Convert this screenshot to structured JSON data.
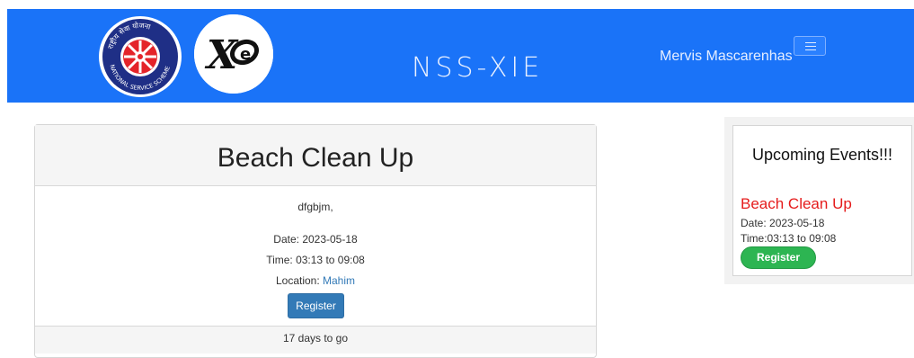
{
  "header": {
    "brand": "NSS-XIE",
    "username": "Mervis Mascarenhas",
    "logos": [
      {
        "name": "nss-logo",
        "alt": "National Service Scheme"
      },
      {
        "name": "xie-logo",
        "alt": "XIE"
      }
    ],
    "nss_logo_text": "राष्ट्रीय सेवा योजना NATIONAL SERVICE SCHEME",
    "xie_logo_text": "XIE",
    "menu_icon": "hamburger-icon",
    "colors": {
      "header_bg": "#1a73f8"
    }
  },
  "event": {
    "title": "Beach Clean Up",
    "description": "dfgbjm,",
    "date": "Date: 2023-05-18",
    "time": "Time: 03:13 to 09:08",
    "location_label": "Location: ",
    "location": "Mahim",
    "register_label": "Register",
    "countdown": "17 days to go",
    "colors": {
      "register_btn": "#337ab7",
      "location_link": "#337ab7"
    }
  },
  "sidebar": {
    "title": "Upcoming Events!!!",
    "event_name": "Beach Clean Up",
    "date": "Date: 2023-05-18",
    "time": "Time:03:13 to 09:08",
    "register_label": "Register",
    "colors": {
      "event_name": "#e51c1c",
      "register_btn": "#2db552"
    }
  }
}
